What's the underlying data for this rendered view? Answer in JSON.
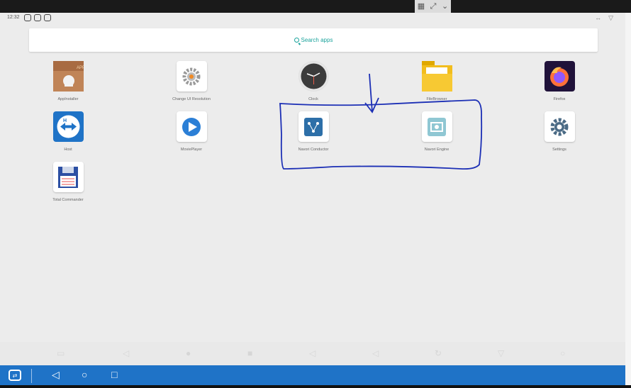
{
  "status_bar": {
    "time": "12:32"
  },
  "viewer_toolbar": {
    "grid_icon": "grid-icon",
    "expand_icon": "expand-icon",
    "chevron_icon": "chevron-down-icon"
  },
  "search": {
    "label": "Search apps"
  },
  "apps": [
    {
      "label": "AppInstaller"
    },
    {
      "label": "Change UI Resolution"
    },
    {
      "label": "Clock"
    },
    {
      "label": "FileBrowser"
    },
    {
      "label": "Firefox"
    },
    {
      "label": "Host"
    },
    {
      "label": "MoviePlayer"
    },
    {
      "label": "Navori Conductor"
    },
    {
      "label": "Navori Engine"
    },
    {
      "label": "Settings"
    },
    {
      "label": "Total Commander"
    }
  ],
  "colors": {
    "accent": "#1ba39c",
    "taskbar": "#1f73c7",
    "annotation": "#1c2fb5"
  }
}
